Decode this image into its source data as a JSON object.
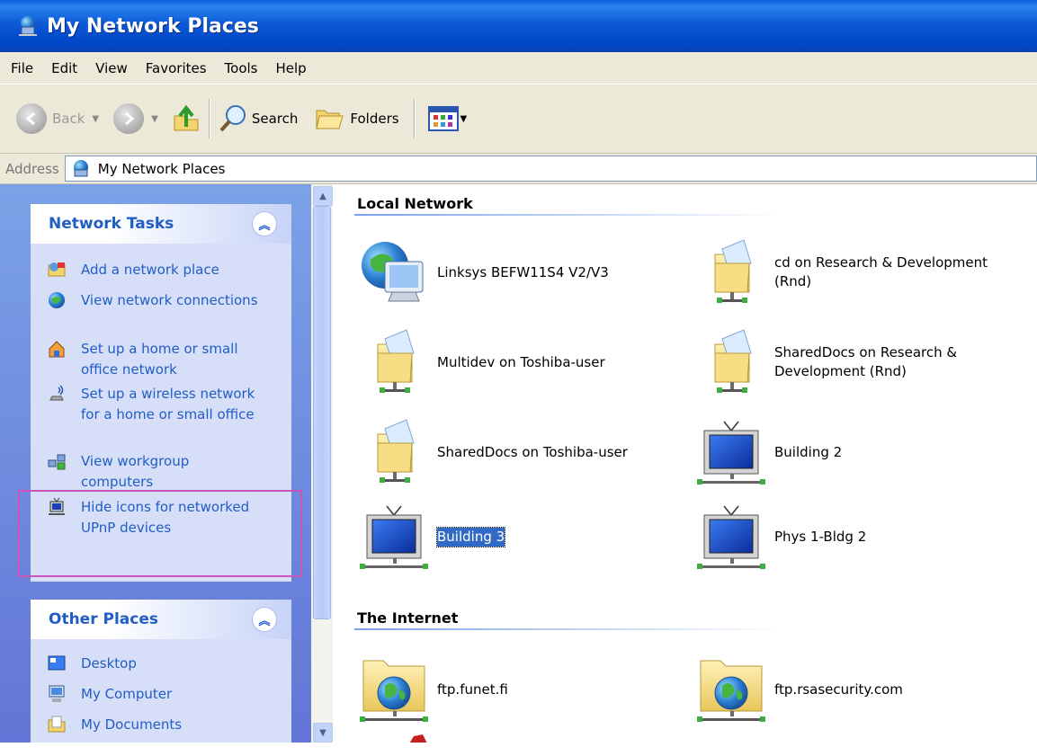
{
  "window": {
    "title": "My Network Places"
  },
  "menu": [
    "File",
    "Edit",
    "View",
    "Favorites",
    "Tools",
    "Help"
  ],
  "toolbar": {
    "back_label": "Back",
    "search_label": "Search",
    "folders_label": "Folders"
  },
  "address": {
    "label": "Address",
    "value": "My Network Places"
  },
  "network_tasks": {
    "title": "Network Tasks",
    "items": [
      {
        "label": "Add a network place",
        "icon": "add-network-place-icon"
      },
      {
        "label": "View network connections",
        "icon": "network-connections-icon"
      },
      {
        "label": "Set up a home or small office network",
        "icon": "home-network-icon"
      },
      {
        "label": "Set up a wireless network for a home or small office",
        "icon": "wireless-network-icon"
      },
      {
        "label": "View workgroup computers",
        "icon": "workgroup-icon"
      },
      {
        "label": "Hide icons for networked UPnP devices",
        "icon": "upnp-device-icon"
      }
    ]
  },
  "other_places": {
    "title": "Other Places",
    "items": [
      {
        "label": "Desktop",
        "icon": "desktop-icon"
      },
      {
        "label": "My Computer",
        "icon": "my-computer-icon"
      },
      {
        "label": "My Documents",
        "icon": "my-documents-icon"
      }
    ]
  },
  "local_network": {
    "title": "Local Network",
    "items": [
      {
        "label": "Linksys BEFW11S4 V2/V3",
        "icon": "router-globe-icon"
      },
      {
        "label": "cd on Research & Development (Rnd)",
        "icon": "network-folder-icon"
      },
      {
        "label": "Multidev on Toshiba-user",
        "icon": "network-folder-icon"
      },
      {
        "label": "SharedDocs on Research & Development (Rnd)",
        "icon": "network-folder-icon"
      },
      {
        "label": "SharedDocs on Toshiba-user",
        "icon": "network-folder-icon"
      },
      {
        "label": "Building 2",
        "icon": "upnp-tv-icon"
      },
      {
        "label": "Building 3",
        "icon": "upnp-tv-icon",
        "selected": true
      },
      {
        "label": "Phys 1-Bldg 2",
        "icon": "upnp-tv-icon"
      }
    ]
  },
  "internet": {
    "title": "The Internet",
    "items": [
      {
        "label": "ftp.funet.fi",
        "icon": "ftp-globe-folder-icon"
      },
      {
        "label": "ftp.rsasecurity.com",
        "icon": "ftp-globe-folder-icon"
      }
    ]
  },
  "colors": {
    "title_bar": "#0a5ddf",
    "task_link": "#215dc6",
    "selection": "#316ac5",
    "annotation_box": "#cc55bb"
  }
}
